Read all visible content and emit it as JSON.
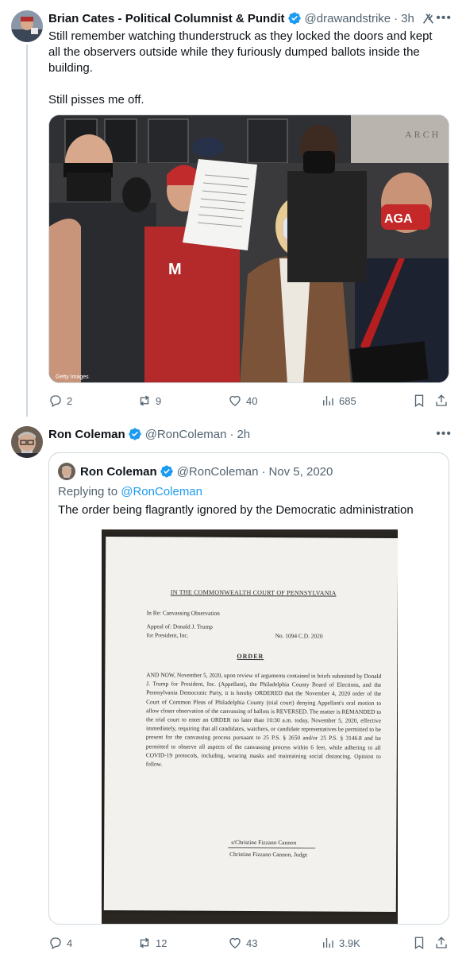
{
  "tweet1": {
    "author_name": "Brian Cates - Political Columnist & Pundit",
    "handle": "@drawandstrike",
    "separator": "·",
    "time": "3h",
    "text_line1": "Still remember watching thunderstruck as they locked the doors and kept",
    "text_line2": "all the observers outside while they furiously dumped ballots inside the",
    "text_line3": "building.",
    "text_line4": "Still pisses me off.",
    "photo_credit": "Getty Images",
    "photo_sign": "ARCH",
    "photo_hat": "AGA",
    "replies": "2",
    "reposts": "9",
    "likes": "40",
    "views": "685"
  },
  "tweet2": {
    "author_name": "Ron Coleman",
    "handle": "@RonColeman",
    "separator": "·",
    "time": "2h",
    "replies": "4",
    "reposts": "12",
    "likes": "43",
    "views": "3.9K"
  },
  "quoted": {
    "author_name": "Ron Coleman",
    "handle": "@RonColeman",
    "separator": "·",
    "date": "Nov 5, 2020",
    "replying_prefix": "Replying to ",
    "replying_handle": "@RonColeman",
    "text": "The order being flagrantly ignored by the Democratic administration",
    "document": {
      "court": "IN THE COMMONWEALTH COURT OF PENNSYLVANIA",
      "in_re": "In Re: Canvassing Observation",
      "appeal_line1": "Appeal of: Donald J. Trump",
      "appeal_line2": "for President, Inc.",
      "case_no": "No. 1094 C.D. 2020",
      "order_heading": "ORDER",
      "body": "AND NOW, November 5, 2020, upon review of arguments contained in briefs submitted by Donald J. Trump for President, Inc. (Appellant), the Philadelphia County Board of Elections, and the Pennsylvania Democratic Party, it is hereby ORDERED that the November 4, 2020 order of the Court of Common Pleas of Philadelphia County (trial court) denying Appellant's oral motion to allow closer observation of the canvassing of ballots is REVERSED. The matter is REMANDED to the trial court to enter an ORDER no later than 10:30 a.m. today, November 5, 2020, effective immediately, requiring that all candidates, watchers, or candidate representatives be permitted to be present for the canvassing process pursuant to 25 P.S. § 2650 and/or 25 P.S. § 3146.8 and be permitted to observe all aspects of the canvassing process within 6 feet, while adhering to all COVID-19 protocols, including, wearing masks and maintaining social distancing. Opinion to follow.",
      "signature": "s/Christine Fizzano Cannon",
      "judge": "Christine Fizzano Cannon, Judge"
    }
  },
  "colors": {
    "text": "#0f1419",
    "secondary": "#536471",
    "accent": "#1d9bf0",
    "border": "#cfd9de"
  },
  "icons": [
    "verified-badge-icon",
    "grok-icon",
    "more-icon",
    "reply-icon",
    "repost-icon",
    "like-icon",
    "views-icon",
    "bookmark-icon",
    "share-icon"
  ]
}
